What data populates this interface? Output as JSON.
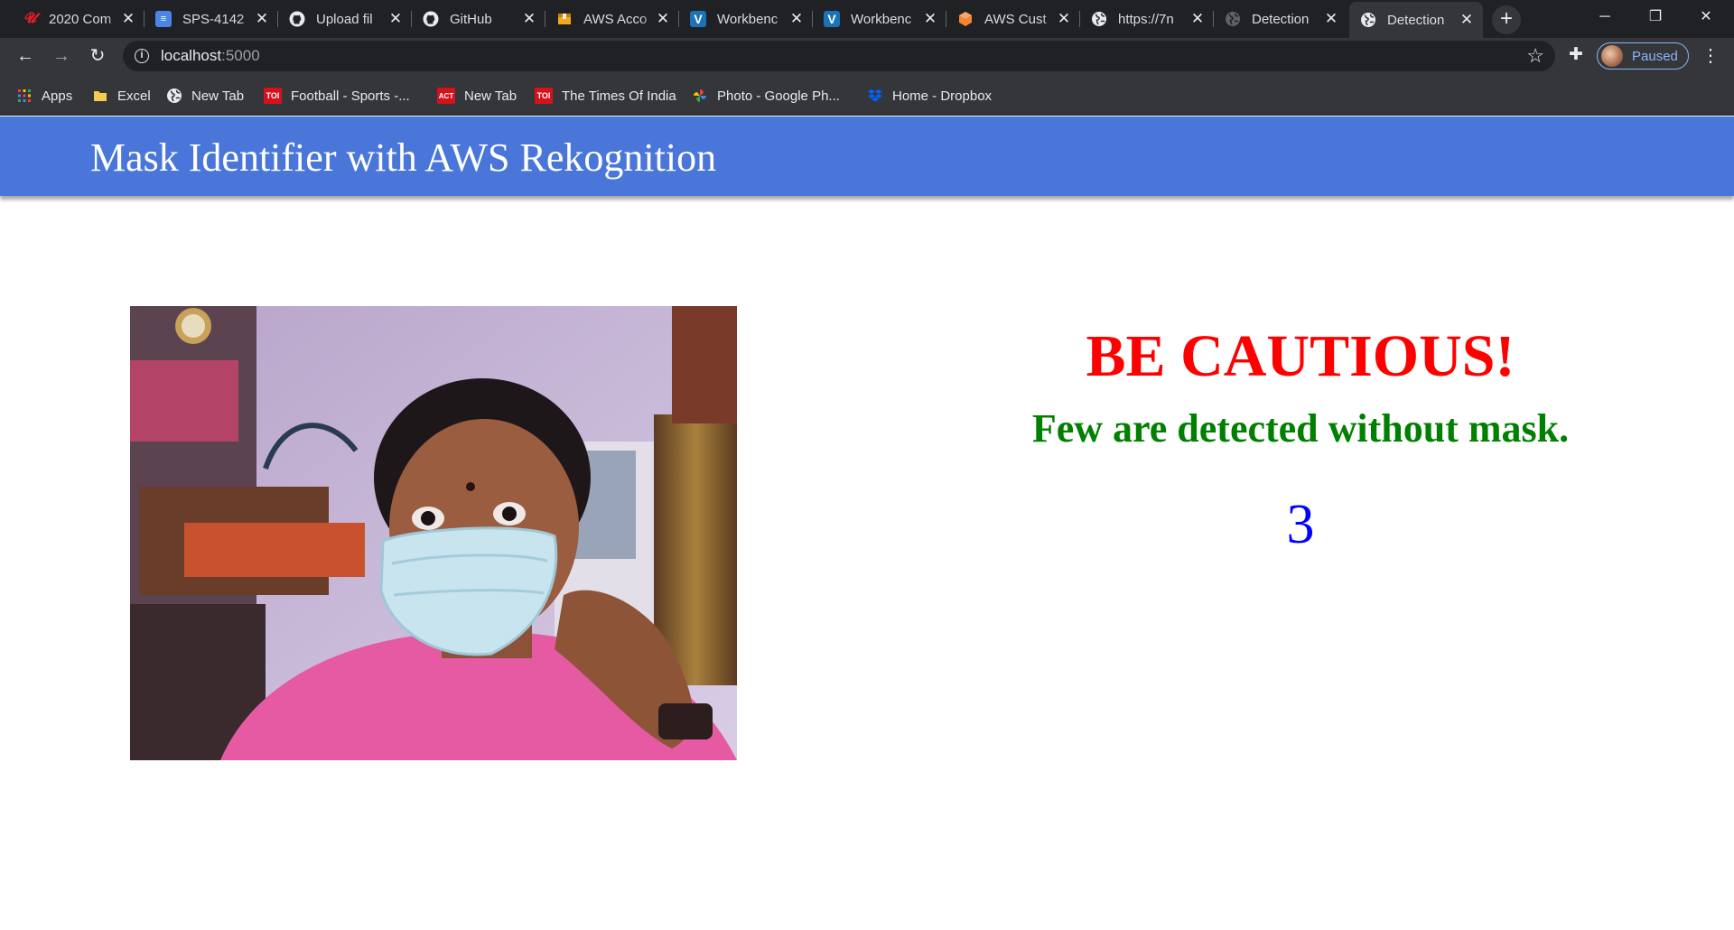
{
  "browser": {
    "tabs": [
      {
        "title": "2020 Com",
        "icon": "adobe-acrobat-icon",
        "color": "#e01f26"
      },
      {
        "title": "SPS-4142",
        "icon": "document-icon",
        "color": "#4a86e8"
      },
      {
        "title": "Upload fil",
        "icon": "github-icon",
        "color": "#e8eaed"
      },
      {
        "title": "GitHub",
        "icon": "github-icon",
        "color": "#e8eaed"
      },
      {
        "title": "AWS Acco",
        "icon": "aws-box-icon",
        "color": "#f4a81d"
      },
      {
        "title": "Workbenc",
        "icon": "v-icon",
        "color": "#1a73b8"
      },
      {
        "title": "Workbenc",
        "icon": "v-icon",
        "color": "#1a73b8"
      },
      {
        "title": "AWS Cust",
        "icon": "aws-cube-icon",
        "color": "#f58534"
      },
      {
        "title": "https://7n",
        "icon": "globe-icon",
        "color": "#e8eaed"
      },
      {
        "title": "Detection",
        "icon": "globe-icon",
        "color": "#9aa0a6"
      },
      {
        "title": "Detection",
        "icon": "globe-icon",
        "color": "#e8eaed",
        "active": true
      }
    ],
    "new_tab": "+",
    "window": {
      "minimize": "─",
      "restore": "❐",
      "close": "✕"
    },
    "address": {
      "host": "localhost",
      "port": ":5000"
    },
    "profile_label": "Paused",
    "bookmarks": [
      {
        "label": "Apps",
        "icon": "apps-grid-icon"
      },
      {
        "label": "Excel",
        "icon": "folder-icon"
      },
      {
        "label": "New Tab",
        "icon": "globe-icon"
      },
      {
        "label": "Football - Sports -...",
        "icon": "toi-icon",
        "badge": "TOI"
      },
      {
        "label": "New Tab",
        "icon": "act-icon",
        "badge": "ACT"
      },
      {
        "label": "The Times Of India",
        "icon": "toi-icon",
        "badge": "TOI"
      },
      {
        "label": "Photo - Google Ph...",
        "icon": "google-photos-icon"
      },
      {
        "label": "Home - Dropbox",
        "icon": "dropbox-icon"
      }
    ]
  },
  "page": {
    "title": "Mask Identifier with AWS Rekognition",
    "result": {
      "heading": "BE CAUTIOUS!",
      "message": "Few are detected without mask.",
      "count": "3"
    }
  },
  "colors": {
    "header": "#4a76d9",
    "caution": "#ff0000",
    "message": "#008000",
    "count": "#0000ff"
  }
}
